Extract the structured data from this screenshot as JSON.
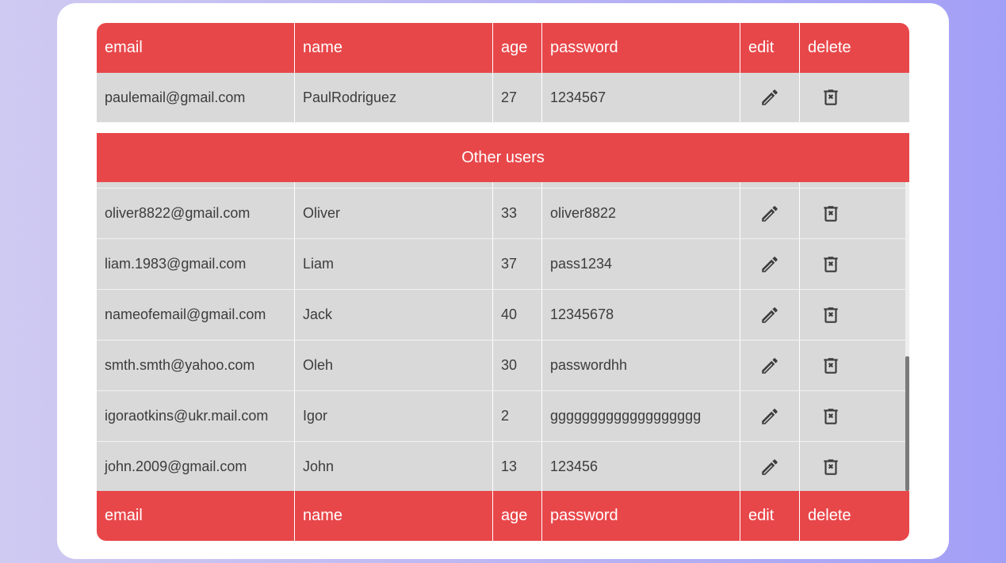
{
  "columns": {
    "email": "email",
    "name": "name",
    "age": "age",
    "password": "password",
    "edit": "edit",
    "delete": "delete"
  },
  "current_user": {
    "email": "paulemail@gmail.com",
    "name": "PaulRodriguez",
    "age": "27",
    "password": "1234567"
  },
  "other_users_title": "Other users",
  "users": [
    {
      "email": "",
      "name": "",
      "age": "",
      "password": ""
    },
    {
      "email": "oliver8822@gmail.com",
      "name": "Oliver",
      "age": "33",
      "password": "oliver8822"
    },
    {
      "email": "liam.1983@gmail.com",
      "name": "Liam",
      "age": "37",
      "password": "pass1234"
    },
    {
      "email": "nameofemail@gmail.com",
      "name": "Jack",
      "age": "40",
      "password": "12345678"
    },
    {
      "email": "smth.smth@yahoo.com",
      "name": "Oleh",
      "age": "30",
      "password": "passwordhh"
    },
    {
      "email": "igoraotkins@ukr.mail.com",
      "name": "Igor",
      "age": "2",
      "password": "ggggggggggggggggggg"
    },
    {
      "email": "john.2009@gmail.com",
      "name": "John",
      "age": "13",
      "password": "123456"
    }
  ],
  "icons": {
    "edit": "pencil-icon",
    "delete": "trash-x-icon"
  },
  "colors": {
    "header": "#e8474a",
    "row": "#d9d9d9",
    "card": "#ffffff"
  }
}
